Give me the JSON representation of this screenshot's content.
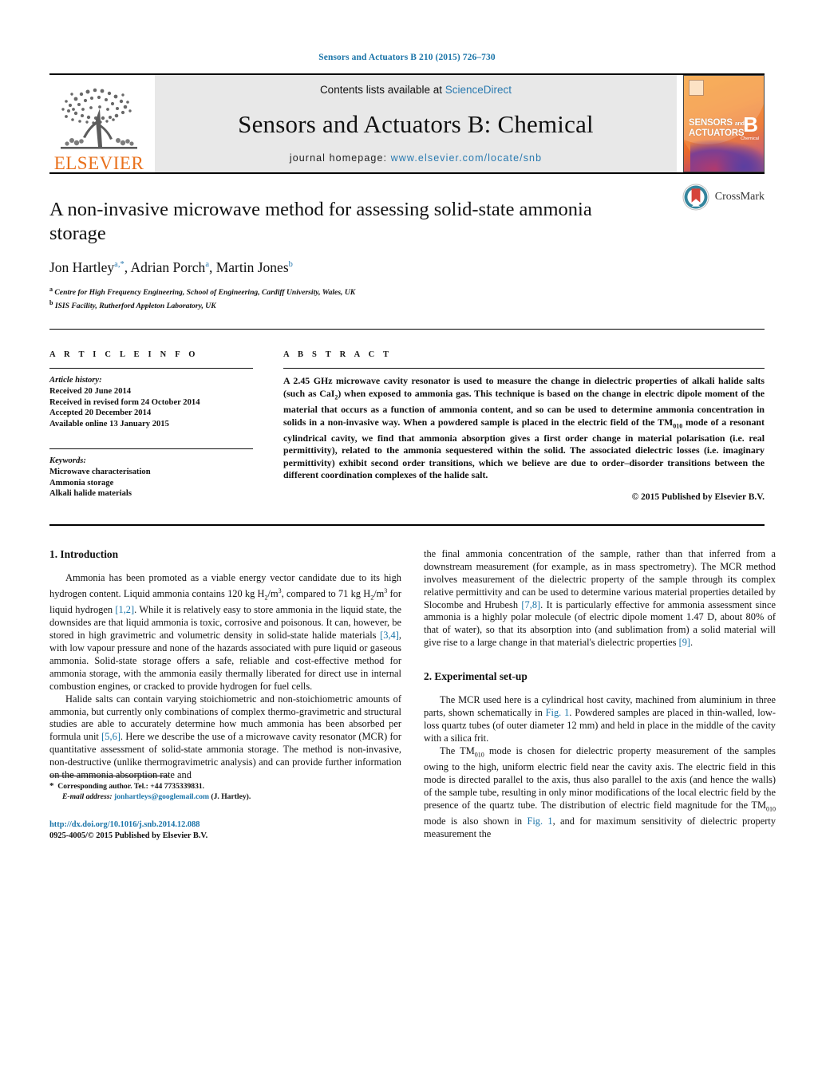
{
  "running_head": "Sensors and Actuators B 210 (2015) 726–730",
  "masthead": {
    "contents_prefix": "Contents lists available at ",
    "sciencedirect": "ScienceDirect",
    "journal_title": "Sensors and Actuators B: Chemical",
    "homepage_prefix": "journal homepage: ",
    "homepage_url": "www.elsevier.com/locate/snb",
    "publisher": "ELSEVIER",
    "cover": {
      "line1": "SENSORS",
      "line1_small": "and",
      "line2": "ACTUATORS",
      "letter": "B",
      "sub": "Chemical"
    }
  },
  "crossmark": {
    "label": "CrossMark"
  },
  "article": {
    "title": "A non-invasive microwave method for assessing solid-state ammonia storage",
    "authors_html": "Jon Hartley<sup>a,*</sup>, Adrian Porch<sup>a</sup>, Martin Jones<sup>b</sup>",
    "affiliations": [
      {
        "marker": "a",
        "text": "Centre for High Frequency Engineering, School of Engineering, Cardiff University, Wales, UK"
      },
      {
        "marker": "b",
        "text": "ISIS Facility, Rutherford Appleton Laboratory, UK"
      }
    ]
  },
  "info": {
    "heading": "A R T I C L E   I N F O",
    "history_label": "Article history:",
    "history": [
      "Received 20 June 2014",
      "Received in revised form 24 October 2014",
      "Accepted 20 December 2014",
      "Available online 13 January 2015"
    ],
    "keywords_label": "Keywords:",
    "keywords": [
      "Microwave characterisation",
      "Ammonia storage",
      "Alkali halide materials"
    ]
  },
  "abstract": {
    "heading": "A B S T R A C T",
    "text_html": "A 2.45 GHz microwave cavity resonator is used to measure the change in dielectric properties of alkali halide salts (such as CaI<sub>2</sub>) when exposed to ammonia gas. This technique is based on the change in electric dipole moment of the material that occurs as a function of ammonia content, and so can be used to determine ammonia concentration in solids in a non-invasive way. When a powdered sample is placed in the electric field of the TM<sub>010</sub> mode of a resonant cylindrical cavity, we find that ammonia absorption gives a first order change in material polarisation (i.e. real permittivity), related to the ammonia sequestered within the solid. The associated dielectric losses (i.e. imaginary permittivity) exhibit second order transitions, which we believe are due to order–disorder transitions between the different coordination complexes of the halide salt.",
    "copyright": "© 2015 Published by Elsevier B.V."
  },
  "body": {
    "section1_heading": "1.  Introduction",
    "section1_p1_html": "Ammonia has been promoted as a viable energy vector candidate due to its high hydrogen content. Liquid ammonia contains 120 kg H<sub>2</sub>/m<sup class=\"num\">3</sup>, compared to 71 kg H<sub>2</sub>/m<sup class=\"num\">3</sup> for liquid hydrogen <span class=\"ref\">[1,2]</span>. While it is relatively easy to store ammonia in the liquid state, the downsides are that liquid ammonia is toxic, corrosive and poisonous. It can, however, be stored in high gravimetric and volumetric density in solid-state halide materials <span class=\"ref\">[3,4]</span>, with low vapour pressure and none of the hazards associated with pure liquid or gaseous ammonia. Solid-state storage offers a safe, reliable and cost-effective method for ammonia storage, with the ammonia easily thermally liberated for direct use in internal combustion engines, or cracked to provide hydrogen for fuel cells.",
    "section1_p2_html": "Halide salts can contain varying stoichiometric and non-stoichiometric amounts of ammonia, but currently only combinations of complex thermo-gravimetric and structural studies are able to accurately determine how much ammonia has been absorbed per formula unit <span class=\"ref\">[5,6]</span>. Here we describe the use of a microwave cavity resonator (MCR) for quantitative assessment of solid-state ammonia storage. The method is non-invasive, non-destructive (unlike thermogravimetric analysis) and can provide further information on the ammonia absorption rate and",
    "section1_p3_html": "the final ammonia concentration of the sample, rather than that inferred from a downstream measurement (for example, as in mass spectrometry). The MCR method involves measurement of the dielectric property of the sample through its complex relative permittivity and can be used to determine various material properties detailed by Slocombe and Hrubesh <span class=\"ref\">[7,8]</span>. It is particularly effective for ammonia assessment since ammonia is a highly polar molecule (of electric dipole moment 1.47 D, about 80% of that of water), so that its absorption into (and sublimation from) a solid material will give rise to a large change in that material's dielectric properties <span class=\"ref\">[9]</span>.",
    "section2_heading": "2.  Experimental set-up",
    "section2_p1_html": "The MCR used here is a cylindrical host cavity, machined from aluminium in three parts, shown schematically in <span class=\"ref\">Fig. 1</span>. Powdered samples are placed in thin-walled, low-loss quartz tubes (of outer diameter 12 mm) and held in place in the middle of the cavity with a silica frit.",
    "section2_p2_html": "The TM<sub>010</sub> mode is chosen for dielectric property measurement of the samples owing to the high, uniform electric field near the cavity axis. The electric field in this mode is directed parallel to the axis, thus also parallel to the axis (and hence the walls) of the sample tube, resulting in only minor modifications of the local electric field by the presence of the quartz tube. The distribution of electric field magnitude for the TM<sub>010</sub> mode is also shown in <span class=\"ref\">Fig. 1</span>, and for maximum sensitivity of dielectric property measurement the"
  },
  "footnote": {
    "corresponding_html": "<span style=\"font-size:11px\">*</span>&nbsp; Corresponding author. Tel.: +44 7735339831.",
    "email_label": "E-mail address:",
    "email": "jonhartleys@googlemail.com",
    "email_owner": "(J. Hartley)."
  },
  "doi_block": {
    "doi": "http://dx.doi.org/10.1016/j.snb.2014.12.088",
    "issn_line": "0925-4005/© 2015 Published by Elsevier B.V."
  },
  "colors": {
    "link_blue": "#1a74a8",
    "elsevier_orange": "#E9711C",
    "crossmark_teal": "#34859d",
    "crossmark_red": "#d6433b"
  }
}
